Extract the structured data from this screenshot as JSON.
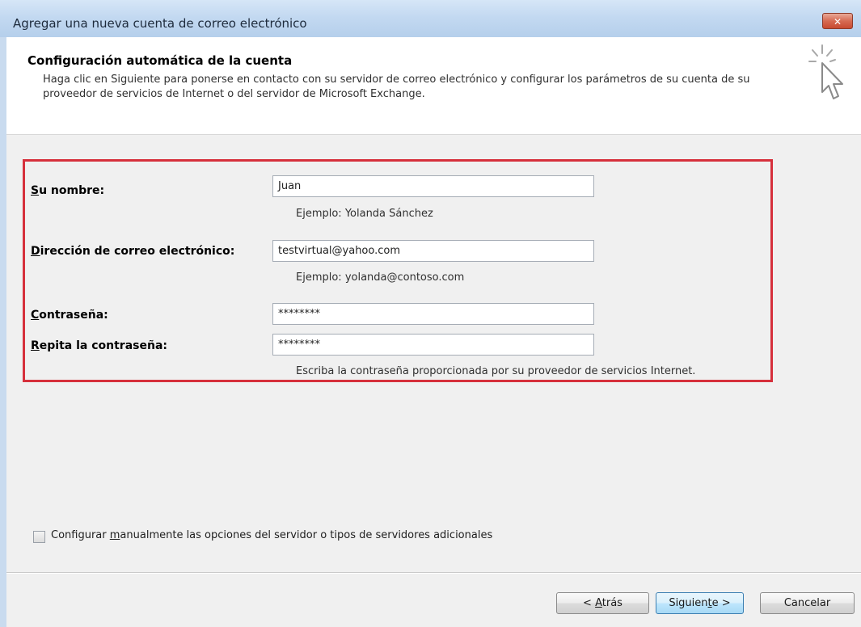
{
  "window": {
    "title": "Agregar una nueva cuenta de correo electrónico",
    "close_label": "✕"
  },
  "header": {
    "title": "Configuración automática de la cuenta",
    "description": "Haga clic en Siguiente para ponerse en contacto con su servidor de correo electrónico y configurar los parámetros de su cuenta de su proveedor de servicios de Internet o del servidor de Microsoft Exchange.",
    "icon": "wizard-cursor-icon"
  },
  "form": {
    "name": {
      "label_accel": "S",
      "label_rest": "u nombre:",
      "value": "Juan",
      "hint": "Ejemplo: Yolanda Sánchez"
    },
    "email": {
      "label_accel": "D",
      "label_rest": "irección de correo electrónico:",
      "value": "testvirtual@yahoo.com",
      "hint": "Ejemplo: yolanda@contoso.com"
    },
    "password": {
      "label_accel": "C",
      "label_rest": "ontraseña:",
      "value": "********"
    },
    "repeat_password": {
      "label_accel": "R",
      "label_rest": "epita la contraseña:",
      "value": "********",
      "hint": "Escriba la contraseña proporcionada por su proveedor de servicios Internet."
    }
  },
  "manual_config": {
    "checked": false,
    "label_pre": "Configurar ",
    "label_accel": "m",
    "label_post": "anualmente las opciones del servidor o tipos de servidores adicionales"
  },
  "buttons": {
    "back_pre": "< ",
    "back_accel": "A",
    "back_post": "trás",
    "next_pre": "Siguien",
    "next_accel": "t",
    "next_post": "e >",
    "cancel": "Cancelar"
  },
  "colors": {
    "highlight_frame": "#d6303c",
    "titlebar": "#c3d9f1"
  }
}
